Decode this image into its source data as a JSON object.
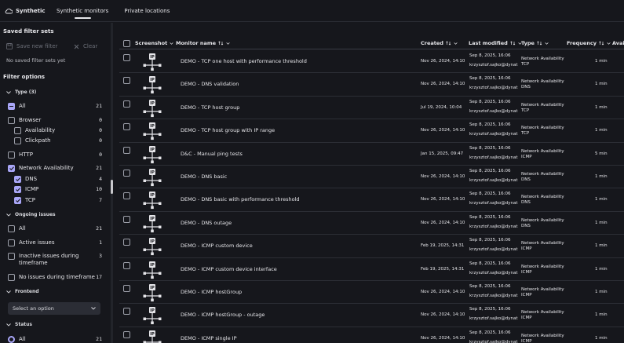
{
  "app": {
    "title": "Synthetic",
    "icon": "cloud-icon"
  },
  "tabs": [
    {
      "label": "Synthetic monitors",
      "active": true
    },
    {
      "label": "Private locations",
      "active": false
    }
  ],
  "sidebar": {
    "saved_title": "Saved filter sets",
    "save_new": "Save new filter",
    "clear": "Clear",
    "no_saved": "No saved filter sets yet",
    "filter_options": "Filter options",
    "type_group": "Type (3)",
    "type_items": [
      {
        "label": "All",
        "count": "21",
        "state": "indeterminate"
      },
      {
        "label": "Browser",
        "count": "0",
        "state": "unchecked"
      },
      {
        "label": "Availability",
        "count": "0",
        "state": "unchecked"
      },
      {
        "label": "Clickpath",
        "count": "0",
        "state": "unchecked"
      },
      {
        "label": "HTTP",
        "count": "0",
        "state": "unchecked"
      },
      {
        "label": "Network Availability",
        "count": "21",
        "state": "checked"
      },
      {
        "label": "DNS",
        "count": "4",
        "state": "checked"
      },
      {
        "label": "ICMP",
        "count": "10",
        "state": "checked"
      },
      {
        "label": "TCP",
        "count": "7",
        "state": "checked"
      }
    ],
    "issues_group": "Ongoing issues",
    "issues_items": [
      {
        "label": "All",
        "count": "21"
      },
      {
        "label": "Active issues",
        "count": "1"
      },
      {
        "label": "Inactive issues during timeframe",
        "count": "3"
      },
      {
        "label": "No issues during timeframe",
        "count": "17"
      }
    ],
    "frontend_group": "Frontend",
    "frontend_select": "Select an option",
    "status_group": "Status",
    "status_all": {
      "label": "All",
      "count": "21"
    }
  },
  "table": {
    "headers": {
      "screenshot": "Screenshot",
      "monitor_name": "Monitor name",
      "created": "Created",
      "last_modified": "Last modified",
      "type": "Type",
      "frequency": "Frequency",
      "avail": "Avail"
    },
    "rows": [
      {
        "name": "DEMO - TCP one host with performance threshold",
        "created": "Nov 26, 2024, 14:10",
        "modified": "Sep 8, 2025, 16:06",
        "user": "krzysztof.sajko@dynat",
        "type": "Network Availability",
        "sub": "TCP",
        "freq": "1 min"
      },
      {
        "name": "DEMO - DNS validation",
        "created": "Nov 26, 2024, 14:10",
        "modified": "Sep 8, 2025, 16:06",
        "user": "krzysztof.sajko@dynat",
        "type": "Network Availability",
        "sub": "DNS",
        "freq": "1 min"
      },
      {
        "name": "DEMO - TCP host group",
        "created": "Jul 19, 2024, 10:04",
        "modified": "Sep 8, 2025, 16:06",
        "user": "krzysztof.sajko@dynat",
        "type": "Network Availability",
        "sub": "TCP",
        "freq": "1 min"
      },
      {
        "name": "DEMO - TCP host group with IP range",
        "created": "Nov 26, 2024, 14:10",
        "modified": "Sep 8, 2025, 16:06",
        "user": "krzysztof.sajko@dynat",
        "type": "Network Availability",
        "sub": "TCP",
        "freq": "1 min"
      },
      {
        "name": "D&C - Manual ping tests",
        "created": "Jan 15, 2025, 09:47",
        "modified": "Sep 8, 2025, 16:06",
        "user": "krzysztof.sajko@dynat",
        "type": "Network Availability",
        "sub": "ICMP",
        "freq": "5 min"
      },
      {
        "name": "DEMO - DNS basic",
        "created": "Nov 26, 2024, 14:10",
        "modified": "Sep 8, 2025, 16:06",
        "user": "krzysztof.sajko@dynat",
        "type": "Network Availability",
        "sub": "DNS",
        "freq": "1 min"
      },
      {
        "name": "DEMO - DNS basic with performance threshold",
        "created": "Nov 26, 2024, 14:10",
        "modified": "Sep 8, 2025, 16:06",
        "user": "krzysztof.sajko@dynat",
        "type": "Network Availability",
        "sub": "DNS",
        "freq": "1 min"
      },
      {
        "name": "DEMO - DNS outage",
        "created": "Nov 26, 2024, 14:10",
        "modified": "Sep 8, 2025, 16:06",
        "user": "krzysztof.sajko@dynat",
        "type": "Network Availability",
        "sub": "DNS",
        "freq": "1 min"
      },
      {
        "name": "DEMO - ICMP custom device",
        "created": "Feb 19, 2025, 14:31",
        "modified": "Sep 8, 2025, 16:06",
        "user": "krzysztof.sajko@dynat",
        "type": "Network Availability",
        "sub": "ICMP",
        "freq": "1 min"
      },
      {
        "name": "DEMO - ICMP custom device interface",
        "created": "Feb 19, 2025, 14:31",
        "modified": "Sep 8, 2025, 16:06",
        "user": "krzysztof.sajko@dynat",
        "type": "Network Availability",
        "sub": "ICMP",
        "freq": "1 min"
      },
      {
        "name": "DEMO - ICMP hostGroup",
        "created": "Nov 26, 2024, 14:10",
        "modified": "Sep 8, 2025, 16:06",
        "user": "krzysztof.sajko@dynat",
        "type": "Network Availability",
        "sub": "ICMP",
        "freq": "1 min"
      },
      {
        "name": "DEMO - ICMP hostGroup - outage",
        "created": "Nov 26, 2024, 14:10",
        "modified": "Sep 8, 2025, 16:06",
        "user": "krzysztof.sajko@dynat",
        "type": "Network Availability",
        "sub": "ICMP",
        "freq": "1 min"
      },
      {
        "name": "DEMO - ICMP single IP",
        "created": "Nov 26, 2024, 14:10",
        "modified": "Sep 8, 2025, 16:06",
        "user": "krzysztof.sajko@dynat",
        "type": "Network Availability",
        "sub": "ICMP",
        "freq": "1 min"
      }
    ]
  }
}
